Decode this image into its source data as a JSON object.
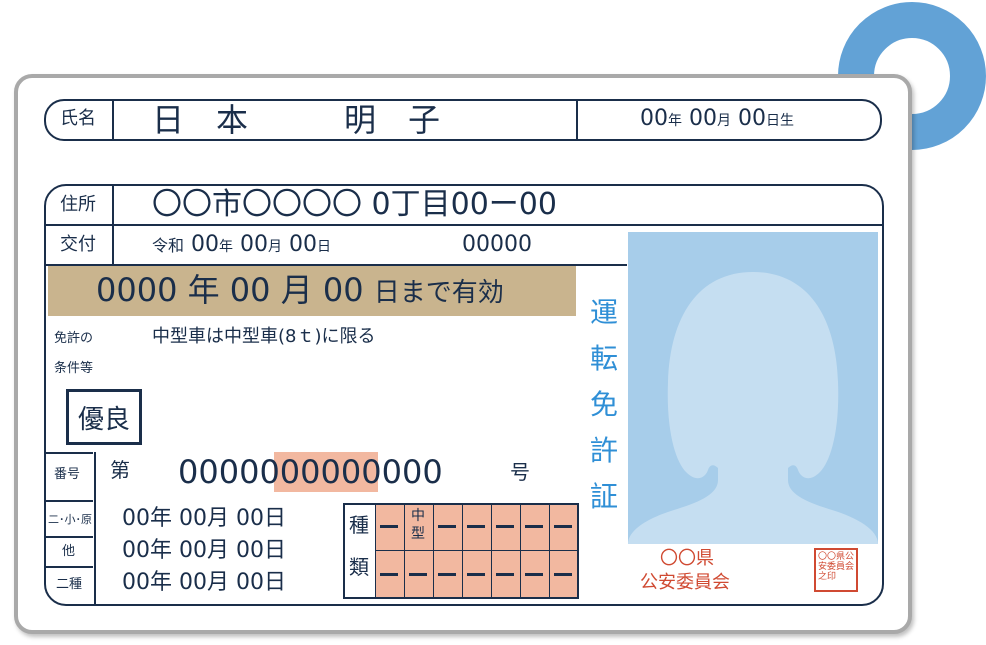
{
  "name_row": {
    "label": "氏名",
    "name": "日　本　　　明　子",
    "birth_year": "00",
    "year_unit": "年",
    "birth_month": "00",
    "month_unit": "月",
    "birth_day": "00",
    "day_unit": "日生"
  },
  "address_row": {
    "label": "住所",
    "value": "〇〇市〇〇〇〇 0丁目00ー00"
  },
  "issue_row": {
    "label": "交付",
    "era": "令和",
    "year": "00",
    "year_unit": "年",
    "month": "00",
    "month_unit": "月",
    "day": "00",
    "day_unit": "日",
    "serial": "00000"
  },
  "validity": {
    "year": "0000",
    "year_unit": "年",
    "month": "00",
    "month_unit": "月",
    "day": "00",
    "suffix": "日まで有効"
  },
  "conditions": {
    "label_line1": "免許の",
    "label_line2": "条件等",
    "value": "中型車は中型車(8ｔ)に限る"
  },
  "excellent_badge": "優良",
  "license_number": {
    "label": "番号",
    "prefix": "第",
    "part1": "0000",
    "part2": "00000",
    "part3": "0000",
    "suffix": "号"
  },
  "category_dates": [
    {
      "label": "二･小･原",
      "value": "00年 00月 00日"
    },
    {
      "label": "他",
      "value": "00年 00月 00日"
    },
    {
      "label": "二種",
      "value": "00年 00月 00日"
    }
  ],
  "type_table": {
    "label_top": "種",
    "label_bottom": "類",
    "medium_line1": "中",
    "medium_line2": "型"
  },
  "vertical_title": [
    "運",
    "転",
    "免",
    "許",
    "証"
  ],
  "issuer": {
    "line1": "〇〇県",
    "line2": "公安委員会"
  },
  "seal_text": "〇〇県公安委員会之印",
  "colors": {
    "ink": "#1a2e4a",
    "accent_blue": "#2f8fd6",
    "photo_bg": "#a7cdea",
    "validity_band": "#c9b48e",
    "highlight": "#f2b8a0",
    "seal_red": "#d04a32"
  }
}
